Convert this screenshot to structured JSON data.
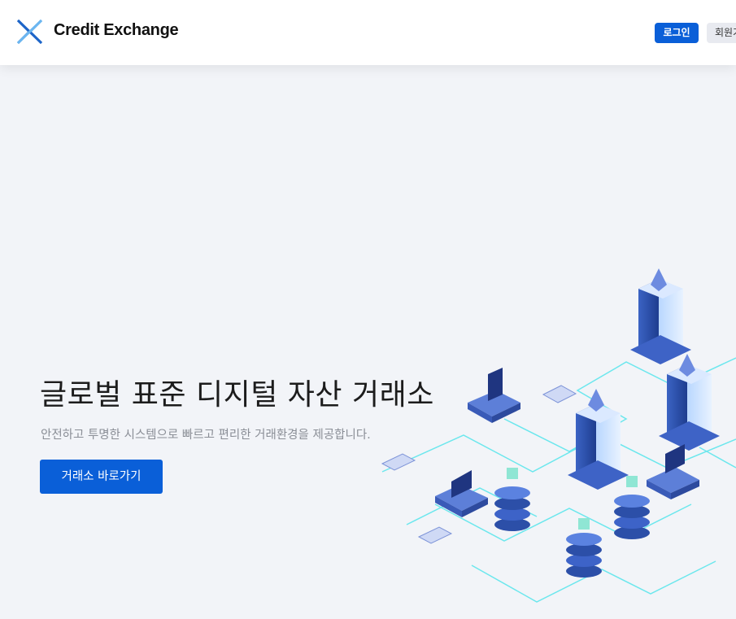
{
  "header": {
    "brand": "Credit Exchange",
    "login_label": "로그인",
    "signup_label": "회원가"
  },
  "hero": {
    "title": "글로벌 표준 디지털 자산 거래소",
    "subtitle": "안전하고 투명한 시스템으로 빠르고 편리한 거래환경을 제공합니다.",
    "cta_label": "거래소 바로가기"
  },
  "colors": {
    "accent": "#0a5fd8",
    "background": "#f2f4f8",
    "circuit": "#5ee6ec",
    "server_blue": "#2c4fa8"
  }
}
